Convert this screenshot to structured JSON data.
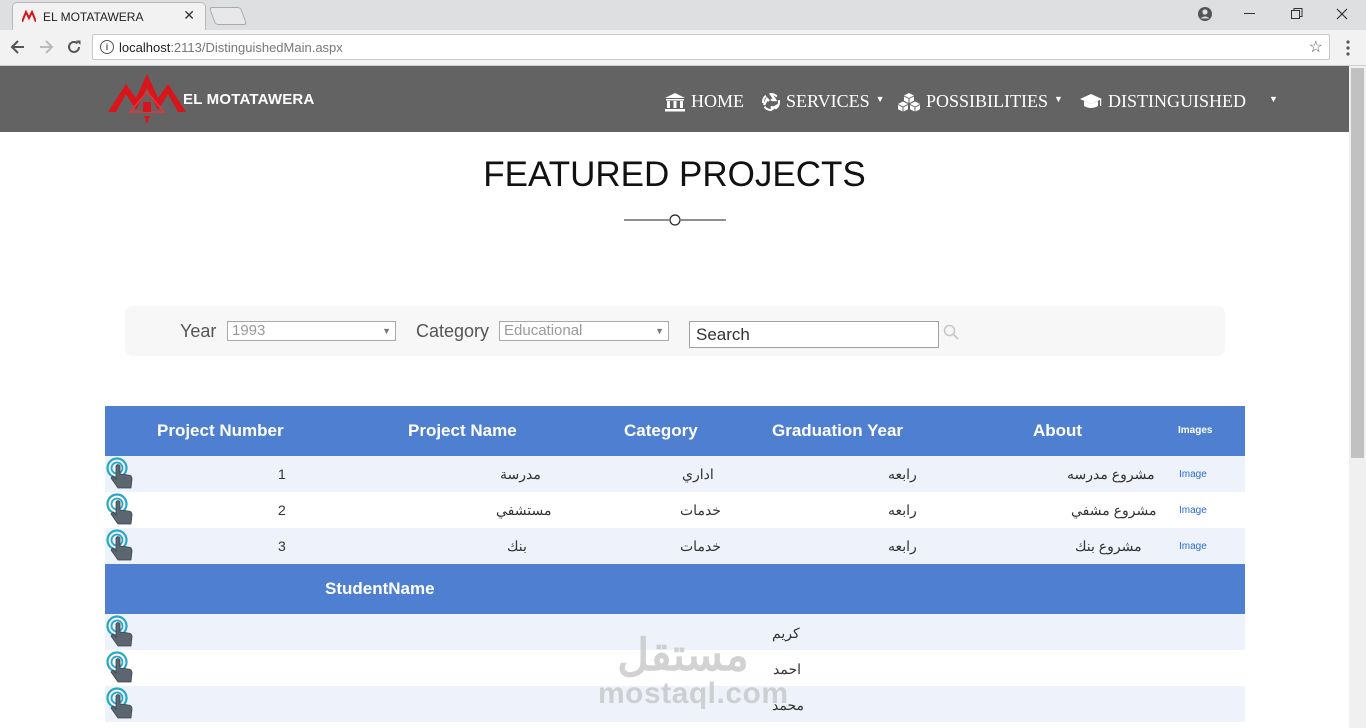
{
  "browser": {
    "tab_title": "EL MOTATAWERA",
    "tab_close": "✕",
    "url_host": "localhost",
    "url_path": ":2113/DistinguishedMain.aspx"
  },
  "navbar": {
    "brand": "EL MOTATAWERA",
    "items": [
      {
        "label": "HOME",
        "icon": "bank-icon"
      },
      {
        "label": "SERVICES",
        "icon": "recycle-icon"
      },
      {
        "label": "POSSIBILITIES",
        "icon": "cubes-icon"
      },
      {
        "label": "DISTINGUISHED",
        "icon": "graduation-cap-icon"
      }
    ]
  },
  "page": {
    "title": "FEATURED PROJECTS"
  },
  "filters": {
    "year_label": "Year",
    "year_value": "1993",
    "category_label": "Category",
    "category_value": "Educational",
    "search_value": "Search"
  },
  "projects": {
    "headers": [
      "Project Number",
      "Project Name",
      "Category",
      "Graduation Year",
      "About",
      "Images"
    ],
    "rows": [
      {
        "number": "1",
        "name": "مدرسة",
        "category": "اداري",
        "year": "رابعه",
        "about": "مشروع مدرسه",
        "images": "Image"
      },
      {
        "number": "2",
        "name": "مستشفي",
        "category": "خدمات",
        "year": "رابعه",
        "about": "مشروع مشفي",
        "images": "Image"
      },
      {
        "number": "3",
        "name": "بنك",
        "category": "خدمات",
        "year": "رابعه",
        "about": "مشروع بنك",
        "images": "Image"
      }
    ]
  },
  "students": {
    "header": "StudentName",
    "rows": [
      "كريم",
      "احمد",
      "محمد"
    ]
  },
  "watermark": {
    "arabic": "مستقل",
    "latin": "mostaql.com"
  },
  "colors": {
    "navbar_bg": "#636363",
    "grid_header_bg": "#4f7fd1",
    "grid_alt_row": "#eef3fb",
    "logo_red": "#d9141b",
    "link_blue": "#2a6bd1"
  }
}
